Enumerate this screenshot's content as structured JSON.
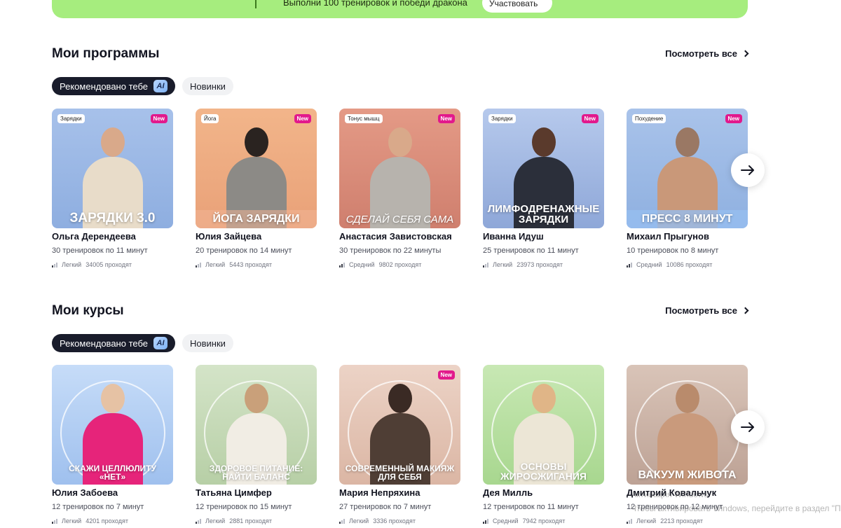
{
  "banner": {
    "text": "Выполни 100 тренировок и победи дракона",
    "button": "Участвовать"
  },
  "programs": {
    "title": "Мои программы",
    "see_all": "Посмотреть все",
    "pills": {
      "recommended": "Рекомендовано тебе",
      "ai": "AI",
      "new": "Новинки"
    },
    "cards": [
      {
        "tag": "Зарядки",
        "new": "New",
        "cover": "ЗАРЯДКИ 3.0",
        "name": "Ольга Дерендеева",
        "meta": "30 тренировок по 11 минут",
        "level": "Легкий",
        "count": "34005 проходят"
      },
      {
        "tag": "Йога",
        "new": "New",
        "cover": "ЙОГА ЗАРЯДКИ",
        "name": "Юлия Зайцева",
        "meta": "20 тренировок по 14 минут",
        "level": "Легкий",
        "count": "5443 проходят"
      },
      {
        "tag": "Тонус мышц",
        "new": "New",
        "cover": "СДЕЛАЙ СЕБЯ САМА",
        "name": "Анастасия Завистовская",
        "meta": "30 тренировок по 22 минуты",
        "level": "Средний",
        "count": "9802 проходят"
      },
      {
        "tag": "Зарядки",
        "new": "New",
        "cover": "ЛИМФОДРЕНАЖНЫЕ ЗАРЯДКИ",
        "name": "Иванна Идуш",
        "meta": "25 тренировок по 11 минут",
        "level": "Легкий",
        "count": "23973 проходят"
      },
      {
        "tag": "Похудение",
        "new": "New",
        "cover": "ПРЕСС 8 МИНУТ",
        "name": "Михаил Прыгунов",
        "meta": "10 тренировок по 8 минут",
        "level": "Средний",
        "count": "10086 проходят"
      }
    ]
  },
  "courses": {
    "title": "Мои курсы",
    "see_all": "Посмотреть все",
    "pills": {
      "recommended": "Рекомендовано тебе",
      "ai": "AI",
      "new": "Новинки"
    },
    "cards": [
      {
        "new": "",
        "cover": "СКАЖИ ЦЕЛЛЮЛИТУ «НЕТ»",
        "name": "Юлия Забоева",
        "meta": "12 тренировок по 7 минут",
        "level": "Легкий",
        "count": "4201 проходят"
      },
      {
        "new": "",
        "cover": "ЗДОРОВОЕ ПИТАНИЕ: НАЙТИ БАЛАНС",
        "name": "Татьяна Цимфер",
        "meta": "12 тренировок по 15 минут",
        "level": "Легкий",
        "count": "2881 проходят"
      },
      {
        "new": "New",
        "cover": "СОВРЕМЕННЫЙ МАКИЯЖ ДЛЯ СЕБЯ",
        "name": "Мария Непряхина",
        "meta": "27 тренировок по 7 минут",
        "level": "Легкий",
        "count": "3336 проходят"
      },
      {
        "new": "",
        "cover": "ОСНОВЫ ЖИРОСЖИГАНИЯ",
        "name": "Дея Милль",
        "meta": "12 тренировок по 11 минут",
        "level": "Средний",
        "count": "7942 проходят"
      },
      {
        "new": "",
        "cover": "ВАКУУМ ЖИВОТА",
        "name": "Дмитрий Ковальчук",
        "meta": "12 тренировок по 12 минут",
        "level": "Легкий",
        "count": "2213 проходят"
      }
    ]
  },
  "watermark": {
    "line1": "Активация Windows",
    "line2": "Чтобы активировать Windows, перейдите в раздел \"Параметры\"."
  }
}
